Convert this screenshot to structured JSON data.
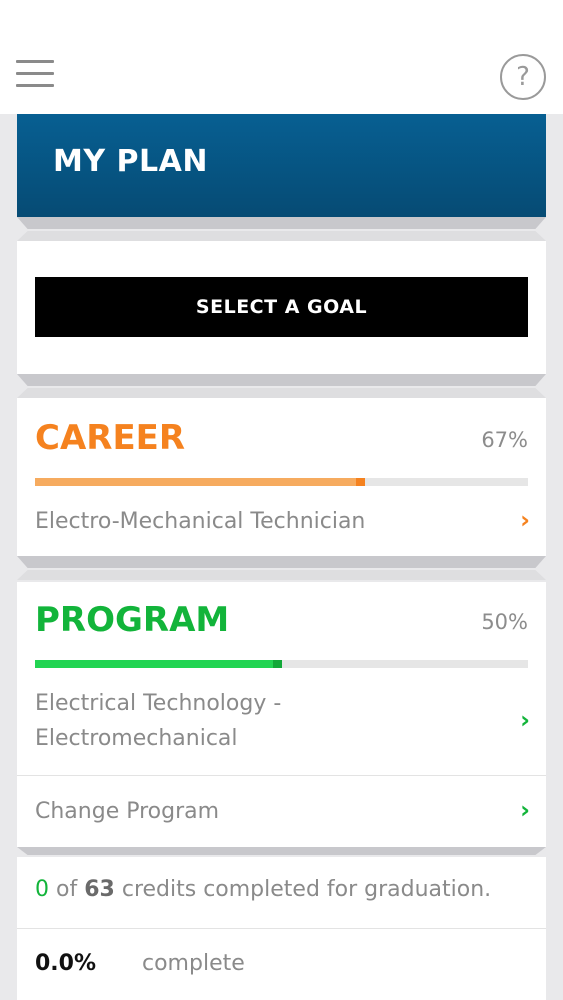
{
  "header": {
    "menu_icon": "hamburger-menu-icon",
    "help_icon": "help-circle-icon",
    "help_glyph": "?"
  },
  "plan": {
    "title": "MY PLAN"
  },
  "goal": {
    "button_label": "SELECT A GOAL"
  },
  "career": {
    "title": "CAREER",
    "percent_label": "67%",
    "progress": 0.67,
    "name": "Electro-Mechanical Technician",
    "accent_color": "#f5821f",
    "bar_color": "#f6ab5f"
  },
  "program": {
    "title": "PROGRAM",
    "percent_label": "50%",
    "progress": 0.5,
    "name_line1": "Electrical Technology -",
    "name_line2": "Electromechanical",
    "change_label": "Change Program",
    "accent_color": "#12b43a",
    "bar_color": "#22d452"
  },
  "credits": {
    "completed": "0",
    "of_text": "of",
    "total": "63",
    "suffix": "credits completed for graduation.",
    "percent_complete": "0.0%",
    "complete_label": "complete"
  },
  "colors": {
    "header_blue": "#065a8a",
    "green": "#12b43a",
    "orange": "#f5821f"
  }
}
